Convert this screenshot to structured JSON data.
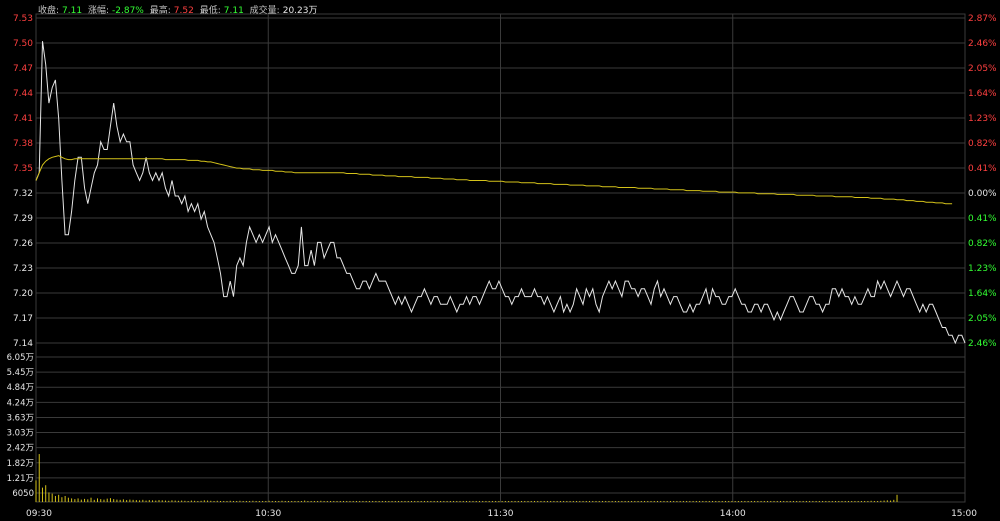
{
  "header": {
    "close_label": "收盘:",
    "close_value": "7.11",
    "change_label": "涨幅:",
    "change_value": "-2.87%",
    "high_label": "最高:",
    "high_value": "7.52",
    "low_label": "最低:",
    "low_value": "7.11",
    "volume_label": "成交量:",
    "volume_value": "20.23万"
  },
  "colors": {
    "background": "#000000",
    "grid": "#3a3a3a",
    "price_line": "#e6e6e6",
    "avg_line": "#d4c21a",
    "volume_bar": "#d4c21a",
    "up": "#ff4040",
    "down": "#33ff33",
    "neutral": "#e6e6e6"
  },
  "chart_data": {
    "type": "line",
    "prev_close": 7.32,
    "price_ticks": [
      "7.53",
      "7.50",
      "7.47",
      "7.44",
      "7.41",
      "7.38",
      "7.35",
      "7.32",
      "7.29",
      "7.26",
      "7.23",
      "7.20",
      "7.17",
      "7.14"
    ],
    "pct_ticks": [
      "2.87%",
      "2.46%",
      "2.05%",
      "1.64%",
      "1.23%",
      "0.82%",
      "0.41%",
      "0.00%",
      "0.41%",
      "0.82%",
      "1.23%",
      "1.64%",
      "2.05%",
      "2.46%"
    ],
    "volume_ticks": [
      "6.05万",
      "5.45万",
      "4.84万",
      "4.24万",
      "3.63万",
      "3.03万",
      "2.42万",
      "1.82万",
      "1.21万",
      "6050"
    ],
    "time_labels": [
      "09:30",
      "10:30",
      "11:30",
      "14:00",
      "15:00"
    ],
    "ylim": [
      7.11,
      7.53
    ],
    "volume_max": 60500,
    "series": [
      {
        "values": [
          7.32,
          7.33,
          7.5,
          7.47,
          7.42,
          7.44,
          7.45,
          7.4,
          7.32,
          7.25,
          7.25,
          7.28,
          7.32,
          7.35,
          7.35,
          7.31,
          7.29,
          7.31,
          7.33,
          7.34,
          7.37,
          7.36,
          7.36,
          7.39,
          7.42,
          7.39,
          7.37,
          7.38,
          7.37,
          7.37,
          7.34,
          7.33,
          7.32,
          7.33,
          7.35,
          7.33,
          7.32,
          7.33,
          7.32,
          7.33,
          7.31,
          7.3,
          7.32,
          7.3,
          7.3,
          7.29,
          7.3,
          7.28,
          7.29,
          7.28,
          7.29,
          7.27,
          7.28,
          7.26,
          7.25,
          7.24,
          7.22,
          7.2,
          7.17,
          7.17,
          7.19,
          7.17,
          7.21,
          7.22,
          7.21,
          7.24,
          7.26,
          7.25,
          7.24,
          7.25,
          7.24,
          7.25,
          7.26,
          7.24,
          7.25,
          7.24,
          7.23,
          7.22,
          7.21,
          7.2,
          7.2,
          7.21,
          7.26,
          7.21,
          7.21,
          7.23,
          7.21,
          7.24,
          7.24,
          7.22,
          7.23,
          7.24,
          7.24,
          7.22,
          7.22,
          7.21,
          7.2,
          7.2,
          7.19,
          7.18,
          7.18,
          7.19,
          7.19,
          7.18,
          7.19,
          7.2,
          7.19,
          7.19,
          7.19,
          7.18,
          7.17,
          7.16,
          7.17,
          7.16,
          7.17,
          7.16,
          7.15,
          7.16,
          7.17,
          7.17,
          7.18,
          7.17,
          7.16,
          7.17,
          7.17,
          7.16,
          7.16,
          7.16,
          7.17,
          7.16,
          7.15,
          7.16,
          7.16,
          7.17,
          7.16,
          7.17,
          7.17,
          7.16,
          7.17,
          7.18,
          7.19,
          7.18,
          7.18,
          7.19,
          7.18,
          7.17,
          7.17,
          7.16,
          7.17,
          7.17,
          7.18,
          7.17,
          7.17,
          7.17,
          7.18,
          7.17,
          7.17,
          7.16,
          7.17,
          7.16,
          7.15,
          7.16,
          7.17,
          7.15,
          7.16,
          7.15,
          7.16,
          7.18,
          7.17,
          7.16,
          7.18,
          7.17,
          7.18,
          7.16,
          7.15,
          7.17,
          7.18,
          7.19,
          7.18,
          7.19,
          7.18,
          7.17,
          7.19,
          7.19,
          7.18,
          7.18,
          7.17,
          7.18,
          7.18,
          7.17,
          7.16,
          7.18,
          7.19,
          7.17,
          7.18,
          7.17,
          7.16,
          7.17,
          7.17,
          7.16,
          7.15,
          7.15,
          7.16,
          7.15,
          7.16,
          7.16,
          7.17,
          7.18,
          7.16,
          7.18,
          7.17,
          7.17,
          7.16,
          7.16,
          7.17,
          7.17,
          7.18,
          7.17,
          7.16,
          7.16,
          7.15,
          7.15,
          7.16,
          7.16,
          7.15,
          7.16,
          7.16,
          7.15,
          7.14,
          7.15,
          7.14,
          7.15,
          7.16,
          7.17,
          7.17,
          7.16,
          7.15,
          7.15,
          7.16,
          7.17,
          7.17,
          7.16,
          7.16,
          7.15,
          7.16,
          7.16,
          7.18,
          7.18,
          7.17,
          7.18,
          7.17,
          7.17,
          7.16,
          7.17,
          7.16,
          7.16,
          7.17,
          7.18,
          7.17,
          7.17,
          7.19,
          7.18,
          7.19,
          7.18,
          7.17,
          7.18,
          7.19,
          7.18,
          7.17,
          7.18,
          7.18,
          7.17,
          7.16,
          7.15,
          7.16,
          7.15,
          7.16,
          7.16,
          7.15,
          7.14,
          7.13,
          7.13,
          7.12,
          7.12,
          7.11,
          7.12,
          7.12,
          7.11
        ],
        "avg": [
          7.32,
          7.33,
          7.34,
          7.345,
          7.348,
          7.35,
          7.351,
          7.352,
          7.35,
          7.348,
          7.347,
          7.347,
          7.348,
          7.348,
          7.348,
          7.348,
          7.348,
          7.348,
          7.348,
          7.348,
          7.348,
          7.348,
          7.348,
          7.348,
          7.348,
          7.348,
          7.348,
          7.348,
          7.348,
          7.348,
          7.348,
          7.348,
          7.348,
          7.348,
          7.348,
          7.348,
          7.348,
          7.348,
          7.348,
          7.348,
          7.347,
          7.347,
          7.347,
          7.347,
          7.347,
          7.347,
          7.347,
          7.346,
          7.346,
          7.346,
          7.346,
          7.345,
          7.345,
          7.344,
          7.344,
          7.343,
          7.342,
          7.341,
          7.34,
          7.339,
          7.338,
          7.337,
          7.336,
          7.336,
          7.335,
          7.335,
          7.335,
          7.334,
          7.334,
          7.334,
          7.333,
          7.333,
          7.333,
          7.333,
          7.332,
          7.332,
          7.332,
          7.331,
          7.331,
          7.331,
          7.33,
          7.33,
          7.33,
          7.33,
          7.33,
          7.33,
          7.33,
          7.33,
          7.33,
          7.33,
          7.33,
          7.33,
          7.33,
          7.33,
          7.33,
          7.33,
          7.329,
          7.329,
          7.329,
          7.329,
          7.328,
          7.328,
          7.328,
          7.328,
          7.327,
          7.327,
          7.327,
          7.327,
          7.326,
          7.326,
          7.326,
          7.326,
          7.325,
          7.325,
          7.325,
          7.325,
          7.325,
          7.324,
          7.324,
          7.324,
          7.324,
          7.324,
          7.323,
          7.323,
          7.323,
          7.323,
          7.322,
          7.322,
          7.322,
          7.322,
          7.321,
          7.321,
          7.321,
          7.321,
          7.32,
          7.32,
          7.32,
          7.32,
          7.32,
          7.32,
          7.319,
          7.319,
          7.319,
          7.319,
          7.319,
          7.318,
          7.318,
          7.318,
          7.318,
          7.318,
          7.317,
          7.317,
          7.317,
          7.317,
          7.317,
          7.316,
          7.316,
          7.316,
          7.316,
          7.316,
          7.315,
          7.315,
          7.315,
          7.315,
          7.315,
          7.314,
          7.314,
          7.314,
          7.314,
          7.314,
          7.313,
          7.313,
          7.313,
          7.313,
          7.313,
          7.312,
          7.312,
          7.312,
          7.312,
          7.312,
          7.311,
          7.311,
          7.311,
          7.311,
          7.311,
          7.311,
          7.31,
          7.31,
          7.31,
          7.31,
          7.31,
          7.309,
          7.309,
          7.309,
          7.309,
          7.309,
          7.308,
          7.308,
          7.308,
          7.308,
          7.308,
          7.307,
          7.307,
          7.307,
          7.307,
          7.307,
          7.306,
          7.306,
          7.306,
          7.306,
          7.306,
          7.305,
          7.305,
          7.305,
          7.305,
          7.305,
          7.305,
          7.304,
          7.304,
          7.304,
          7.304,
          7.304,
          7.304,
          7.303,
          7.303,
          7.303,
          7.303,
          7.303,
          7.303,
          7.302,
          7.302,
          7.302,
          7.302,
          7.302,
          7.302,
          7.301,
          7.301,
          7.301,
          7.301,
          7.301,
          7.301,
          7.3,
          7.3,
          7.3,
          7.3,
          7.3,
          7.3,
          7.299,
          7.299,
          7.299,
          7.299,
          7.299,
          7.299,
          7.298,
          7.298,
          7.298,
          7.298,
          7.298,
          7.297,
          7.297,
          7.297,
          7.297,
          7.296,
          7.296,
          7.296,
          7.296,
          7.295,
          7.295,
          7.295,
          7.294,
          7.294,
          7.294,
          7.293,
          7.293,
          7.293,
          7.292,
          7.292,
          7.292,
          7.291,
          7.291,
          7.291,
          7.29,
          7.29,
          7.29
        ],
        "volume": [
          9000,
          20000,
          6000,
          7000,
          4000,
          3500,
          2500,
          3000,
          2000,
          2500,
          1800,
          1500,
          1200,
          1500,
          1000,
          1300,
          1100,
          1800,
          900,
          1500,
          1200,
          1000,
          1400,
          1600,
          1200,
          1000,
          900,
          1100,
          800,
          1000,
          900,
          800,
          700,
          900,
          600,
          800,
          700,
          600,
          800,
          700,
          600,
          500,
          700,
          600,
          500,
          600,
          500,
          400,
          600,
          500,
          400,
          500,
          700,
          600,
          500,
          400,
          500,
          400,
          300,
          400,
          500,
          300,
          400,
          500,
          400,
          300,
          400,
          500,
          300,
          400,
          300,
          400,
          500,
          300,
          400,
          300,
          500,
          400,
          300,
          400,
          300,
          400,
          300,
          600,
          400,
          300,
          400,
          300,
          500,
          400,
          300,
          400,
          300,
          400,
          300,
          200,
          300,
          400,
          300,
          200,
          300,
          400,
          300,
          200,
          300,
          400,
          300,
          200,
          300,
          200,
          300,
          400,
          300,
          200,
          300,
          200,
          300,
          200,
          300,
          200,
          300,
          200,
          300,
          200,
          300,
          200,
          300,
          200,
          300,
          200,
          300,
          200,
          300,
          200,
          300,
          200,
          300,
          200,
          300,
          200,
          300,
          200,
          300,
          400,
          300,
          200,
          300,
          200,
          300,
          200,
          300,
          200,
          300,
          200,
          300,
          200,
          300,
          200,
          300,
          200,
          300,
          200,
          300,
          200,
          300,
          200,
          300,
          400,
          300,
          200,
          300,
          200,
          300,
          200,
          300,
          200,
          300,
          200,
          300,
          200,
          300,
          200,
          300,
          200,
          300,
          200,
          300,
          200,
          300,
          200,
          300,
          200,
          300,
          200,
          300,
          200,
          300,
          200,
          300,
          200,
          300,
          200,
          300,
          200,
          300,
          200,
          300,
          400,
          300,
          200,
          300,
          200,
          300,
          200,
          300,
          200,
          300,
          200,
          300,
          200,
          300,
          200,
          300,
          200,
          300,
          200,
          300,
          400,
          300,
          200,
          300,
          200,
          300,
          200,
          300,
          400,
          300,
          200,
          300,
          200,
          300,
          200,
          300,
          200,
          300,
          200,
          300,
          200,
          300,
          200,
          300,
          400,
          300,
          200,
          300,
          200,
          300,
          400,
          500,
          400,
          300,
          500,
          600,
          700,
          600,
          900,
          3000
        ]
      }
    ]
  }
}
